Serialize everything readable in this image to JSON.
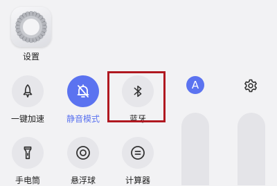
{
  "app": {
    "settings_label": "设置"
  },
  "tiles": [
    {
      "label": "一键加速",
      "icon": "rocket-icon",
      "active": false
    },
    {
      "label": "静音模式",
      "icon": "bell-off-icon",
      "active": true
    },
    {
      "label": "蓝牙",
      "icon": "bluetooth-icon",
      "active": false
    },
    {
      "label": "手电筒",
      "icon": "flashlight-icon",
      "active": false
    },
    {
      "label": "悬浮球",
      "icon": "floating-ball-icon",
      "active": false
    },
    {
      "label": "计算器",
      "icon": "calculator-icon",
      "active": false
    }
  ],
  "font_button": {
    "glyph": "A"
  },
  "colors": {
    "accent": "#5b73f0",
    "highlight_box": "#b01820",
    "tile_bg": "#e6e6ea",
    "background": "#f2f2f4"
  }
}
